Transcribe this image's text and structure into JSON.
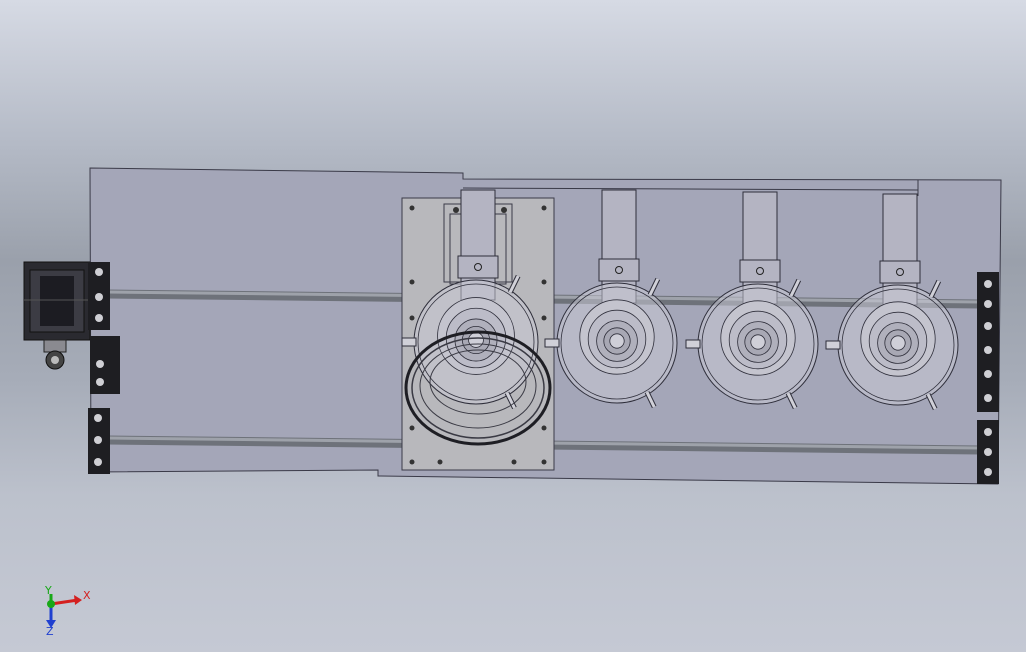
{
  "viewport": {
    "background_top": "#d6dae4",
    "background_mid": "#9aa0ab",
    "background_bottom": "#c5c9d4"
  },
  "colors": {
    "plate_fill": "#a4a6b8",
    "plate_stroke": "#3a3a48",
    "edge_line": "#2e2e3a",
    "rail": "#8a8e96",
    "carriage_fill": "#b8b8bc",
    "bracket_dark": "#1e1e22",
    "transparent_fill": "#c8c8d4",
    "axis_x": "#d42020",
    "axis_y": "#18a818",
    "axis_z": "#2040d0"
  },
  "icons": {
    "motor": "stepper-motor-icon",
    "bracket": "mounting-bracket-icon",
    "bowl": "feeder-bowl-icon",
    "triad": "coordinate-triad-icon"
  },
  "assembly": {
    "feeder_count": 4,
    "rail_count": 2
  },
  "triad": {
    "x_label": "X",
    "y_label": "Y",
    "z_label": "Z"
  }
}
